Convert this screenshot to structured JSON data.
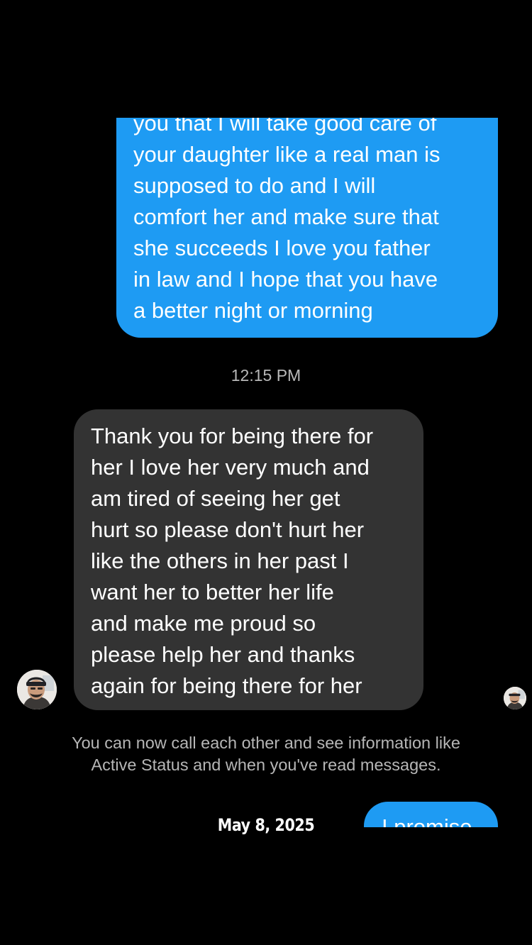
{
  "conversation": {
    "outgoing_message": {
      "lines": [
        "you that I will take good care of",
        "your daughter like a real man is",
        "supposed to do and I will",
        "comfort her and make sure that",
        "she succeeds I love you father",
        "in law and I hope that you have",
        "a better night or morning"
      ],
      "bubble_color": "#1e9bf3"
    },
    "timestamp": "12:15 PM",
    "incoming_message": {
      "lines": [
        "Thank you for being there for",
        "her I love her very much and",
        "am tired of seeing her get",
        "hurt so please don't hurt her",
        "like the others in her past I",
        "want her to better her life",
        "and make me proud so",
        "please help her and thanks",
        "again for being there for her"
      ],
      "bubble_color": "#333333"
    },
    "system_notice": {
      "line1": "You can now call each other and see information like",
      "line2": "Active Status and when you've read messages."
    },
    "partial_outgoing_message": "I promise"
  },
  "avatars": {
    "sender": "profile-photo-icon",
    "read_receipt": "profile-photo-icon"
  },
  "caption": {
    "date": "May 8, 2025"
  }
}
